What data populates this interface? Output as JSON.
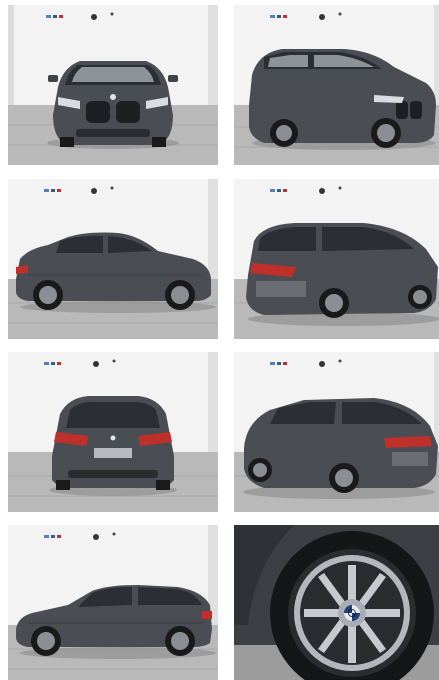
{
  "gallery": {
    "photos": [
      {
        "view": "front"
      },
      {
        "view": "front-three-quarter-right"
      },
      {
        "view": "side-left"
      },
      {
        "view": "rear-three-quarter-left"
      },
      {
        "view": "rear"
      },
      {
        "view": "rear-three-quarter-right"
      },
      {
        "view": "front-three-quarter-left"
      },
      {
        "view": "wheel-detail"
      }
    ]
  },
  "colors": {
    "car_body": "#4a4d54",
    "floor": "#b8b8b8",
    "wall": "#f2f2f2",
    "taillight": "#c0302a"
  }
}
